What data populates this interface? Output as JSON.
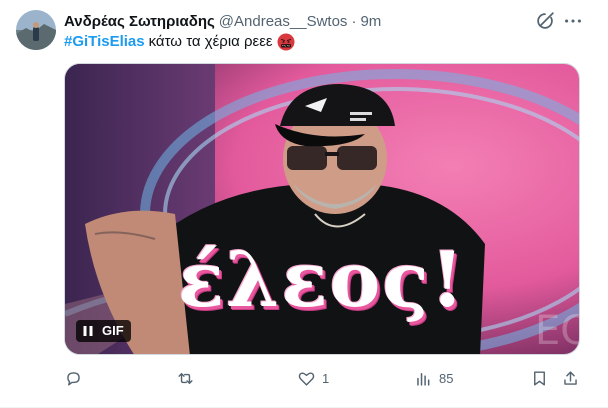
{
  "tweet": {
    "author_name": "Ανδρέας Σωτηριαδης",
    "handle": "@Andreas__Swtos",
    "separator": "·",
    "time": "9m",
    "hashtag": "#GiTisElias",
    "text": "κάτω τα χέρια ρεεε",
    "emoji": "angry-face-with-symbols-emoji"
  },
  "media": {
    "caption": "έλεος!",
    "gif_label": "GIF",
    "pause_icon": "pause-icon"
  },
  "actions": {
    "reply_count": "",
    "retweet_count": "",
    "like_count": "1",
    "views_count": "85"
  },
  "colors": {
    "accent": "#1d9bf0",
    "text_secondary": "#536471",
    "background": "#ffffff",
    "caption_pink": "#e9579e"
  }
}
